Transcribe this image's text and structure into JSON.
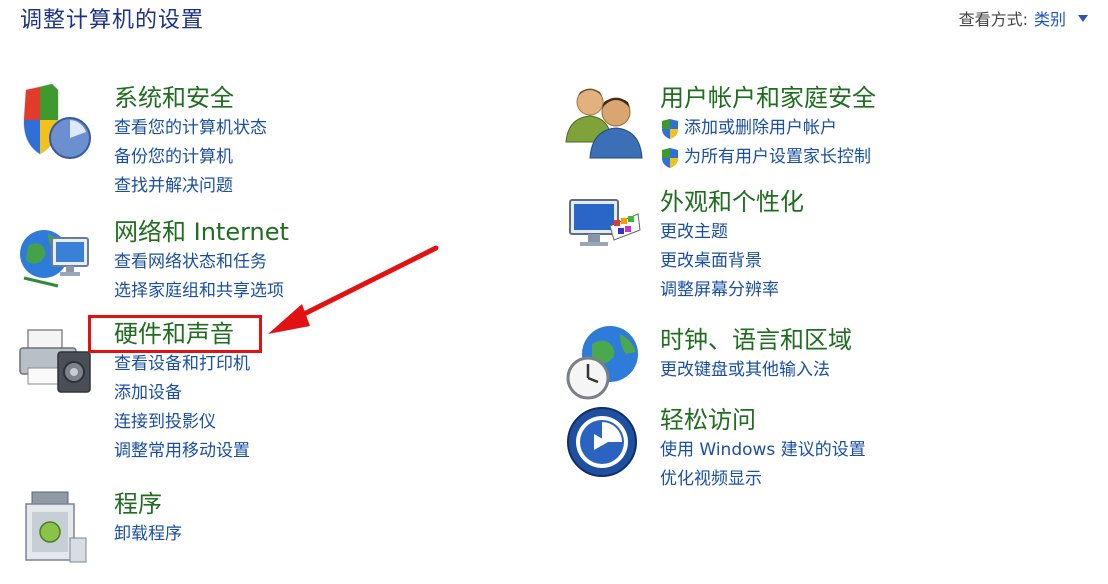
{
  "header": {
    "title": "调整计算机的设置",
    "view_by_label": "查看方式:",
    "view_by_value": "类别"
  },
  "categories": [
    {
      "title": "系统和安全",
      "icon": "system-security-icon",
      "links": [
        "查看您的计算机状态",
        "备份您的计算机",
        "查找并解决问题"
      ]
    },
    {
      "title": "网络和 Internet",
      "icon": "network-icon",
      "links": [
        "查看网络状态和任务",
        "选择家庭组和共享选项"
      ]
    },
    {
      "title": "硬件和声音",
      "icon": "hardware-printer-icon",
      "links": [
        "查看设备和打印机",
        "添加设备",
        "连接到投影仪",
        "调整常用移动设置"
      ]
    },
    {
      "title": "程序",
      "icon": "programs-icon",
      "links": [
        "卸载程序"
      ]
    },
    {
      "title": "用户帐户和家庭安全",
      "icon": "users-icon",
      "links": [
        "添加或删除用户帐户",
        "为所有用户设置家长控制"
      ]
    },
    {
      "title": "外观和个性化",
      "icon": "appearance-icon",
      "links": [
        "更改主题",
        "更改桌面背景",
        "调整屏幕分辨率"
      ]
    },
    {
      "title": "时钟、语言和区域",
      "icon": "clock-globe-icon",
      "links": [
        "更改键盘或其他输入法"
      ]
    },
    {
      "title": "轻松访问",
      "icon": "ease-of-access-icon",
      "links": [
        "使用 Windows 建议的设置",
        "优化视频显示"
      ]
    }
  ],
  "annotation": {
    "highlight_color": "#e21212",
    "target": "硬件和声音"
  }
}
